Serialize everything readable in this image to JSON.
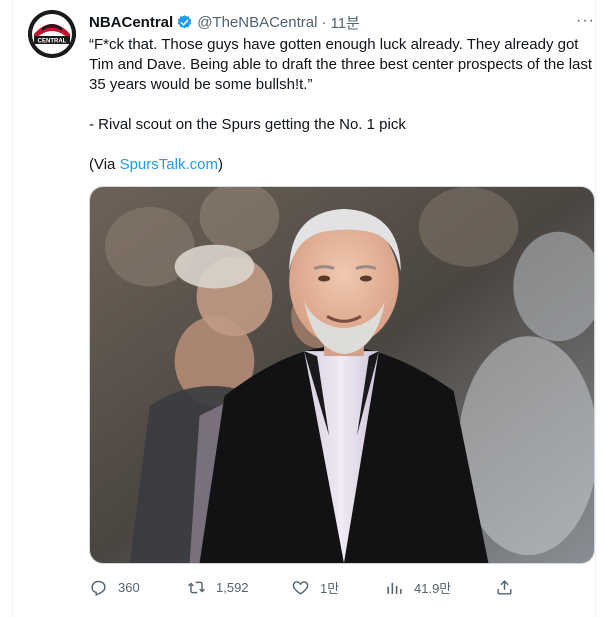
{
  "tweet": {
    "author_name": "NBACentral",
    "handle": "@TheNBACentral",
    "separator": "·",
    "time": "11분",
    "avatar_text": "CENTRAL",
    "more_icon": "···",
    "text_lines": [
      "“F*ck that. Those guys have gotten enough luck already. They already got Tim and Dave. Being able to draft the three best center prospects of the last 35 years would be some bullsh!t.”",
      "- Rival scout on the Spurs getting the No. 1 pick"
    ],
    "via_prefix": "(Via ",
    "via_link": "SpursTalk.com",
    "via_suffix": ")",
    "media_alt": "Photo of a smiling gray-haired coach in a black suit"
  },
  "actions": {
    "reply_count": "360",
    "retweet_count": "1,592",
    "like_count": "1만",
    "view_count": "41.9만"
  },
  "colors": {
    "link": "#1d9bf0",
    "verified": "#1d9bf0",
    "secondary_text": "#536471"
  }
}
